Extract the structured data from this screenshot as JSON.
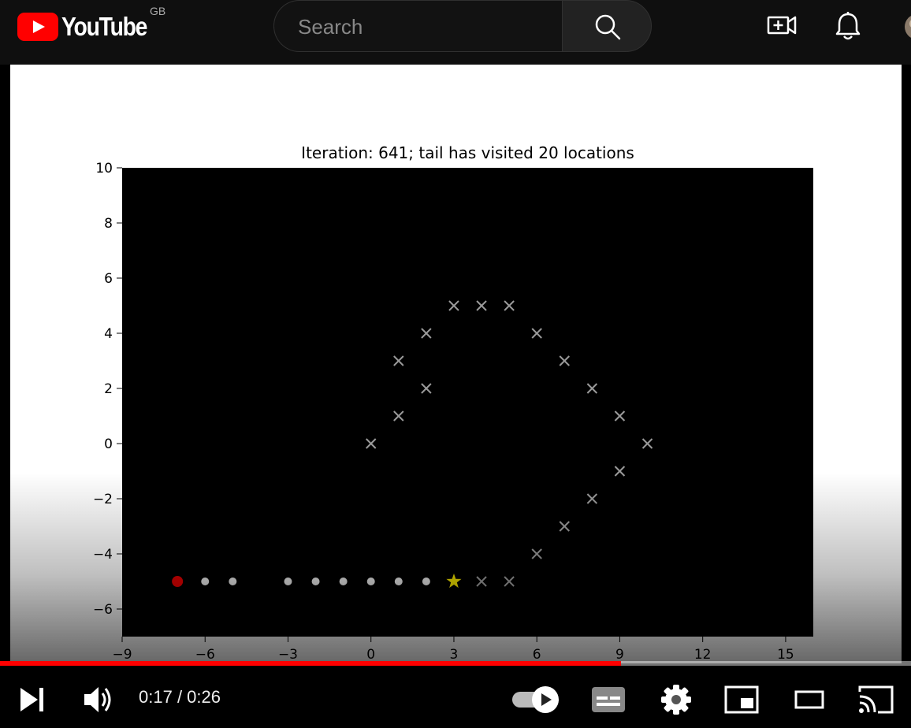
{
  "header": {
    "logo_text": "YouTube",
    "country_code": "GB",
    "search_placeholder": "Search",
    "icons": [
      "youtube-logo-icon",
      "search-icon",
      "create-video-icon",
      "notifications-bell-icon",
      "avatar"
    ]
  },
  "player": {
    "current_time": "0:17",
    "duration": "0:26",
    "time_separator": " / ",
    "progress_fraction": 0.6815,
    "progress_color": "#ff0000",
    "icons": [
      "next-icon",
      "volume-icon",
      "autoplay-toggle-icon",
      "subtitles-icon",
      "settings-icon",
      "miniplayer-icon",
      "theater-mode-icon",
      "cast-icon"
    ]
  },
  "chart_data": {
    "type": "scatter",
    "title": "Iteration: 641; tail has visited 20 locations",
    "xlim": [
      -9,
      16
    ],
    "ylim": [
      -7,
      10
    ],
    "xticks": [
      -9,
      -6,
      -3,
      0,
      3,
      6,
      9,
      12,
      15
    ],
    "yticks": [
      -6,
      -4,
      -2,
      0,
      2,
      4,
      6,
      8,
      10
    ],
    "grid": false,
    "background": "#000000",
    "series": [
      {
        "marker": "x",
        "color": "#9a9a9a",
        "points": [
          [
            0,
            0
          ],
          [
            1,
            1
          ],
          [
            1,
            3
          ],
          [
            2,
            2
          ],
          [
            2,
            4
          ],
          [
            3,
            5
          ],
          [
            4,
            5
          ],
          [
            5,
            5
          ],
          [
            6,
            4
          ],
          [
            7,
            3
          ],
          [
            8,
            2
          ],
          [
            9,
            1
          ],
          [
            10,
            0
          ],
          [
            9,
            -1
          ],
          [
            8,
            -2
          ],
          [
            7,
            -3
          ],
          [
            6,
            -4
          ],
          [
            5,
            -5
          ],
          [
            4,
            -5
          ]
        ]
      },
      {
        "marker": "dot",
        "color": "#e6e6e6",
        "points": [
          [
            -6,
            -5
          ],
          [
            -5,
            -5
          ],
          [
            -3,
            -5
          ],
          [
            -2,
            -5
          ],
          [
            -1,
            -5
          ],
          [
            0,
            -5
          ],
          [
            1,
            -5
          ],
          [
            2,
            -5
          ]
        ]
      },
      {
        "marker": "dot-large",
        "color": "#e00000",
        "points": [
          [
            -7,
            -5
          ]
        ]
      },
      {
        "marker": "star",
        "color": "#f0e000",
        "points": [
          [
            3,
            -5
          ]
        ]
      }
    ]
  }
}
